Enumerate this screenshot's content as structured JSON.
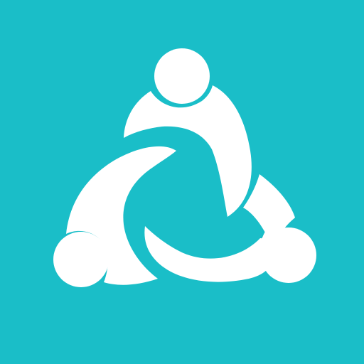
{
  "icon": {
    "name": "three-people-circle-logo",
    "background_color": "#1abec8",
    "figure_color": "#ffffff",
    "figure_count": 3
  }
}
